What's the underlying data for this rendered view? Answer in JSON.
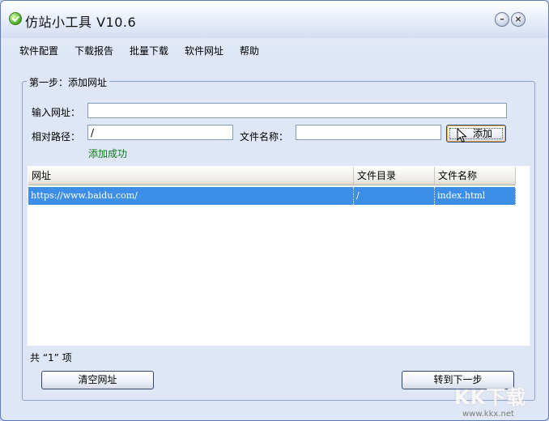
{
  "window": {
    "title": "仿站小工具 V10.6",
    "minimize_label": "–",
    "close_label": "×"
  },
  "menu": [
    "软件配置",
    "下载报告",
    "批量下载",
    "软件网址",
    "帮助"
  ],
  "step_group": {
    "legend": "第一步：添加网址",
    "url_label": "输入网址：",
    "url_value": "",
    "path_label": "相对路径：",
    "path_value": "/",
    "filename_label": "文件名称：",
    "filename_value": "",
    "add_button": "添加",
    "status": "添加成功"
  },
  "table": {
    "columns": [
      "网址",
      "文件目录",
      "文件名称"
    ],
    "rows": [
      {
        "url": "https://www.baidu.com/",
        "dir": "/",
        "file": "index.html",
        "selected": true
      }
    ]
  },
  "count_text": "共 “1” 项",
  "buttons": {
    "clear": "清空网址",
    "next": "转到下一步"
  },
  "watermark": {
    "logo": "KK下载",
    "url": "www.kkx.net"
  },
  "colors": {
    "selection": "#3d8ee6",
    "status": "#0a7a1a"
  }
}
